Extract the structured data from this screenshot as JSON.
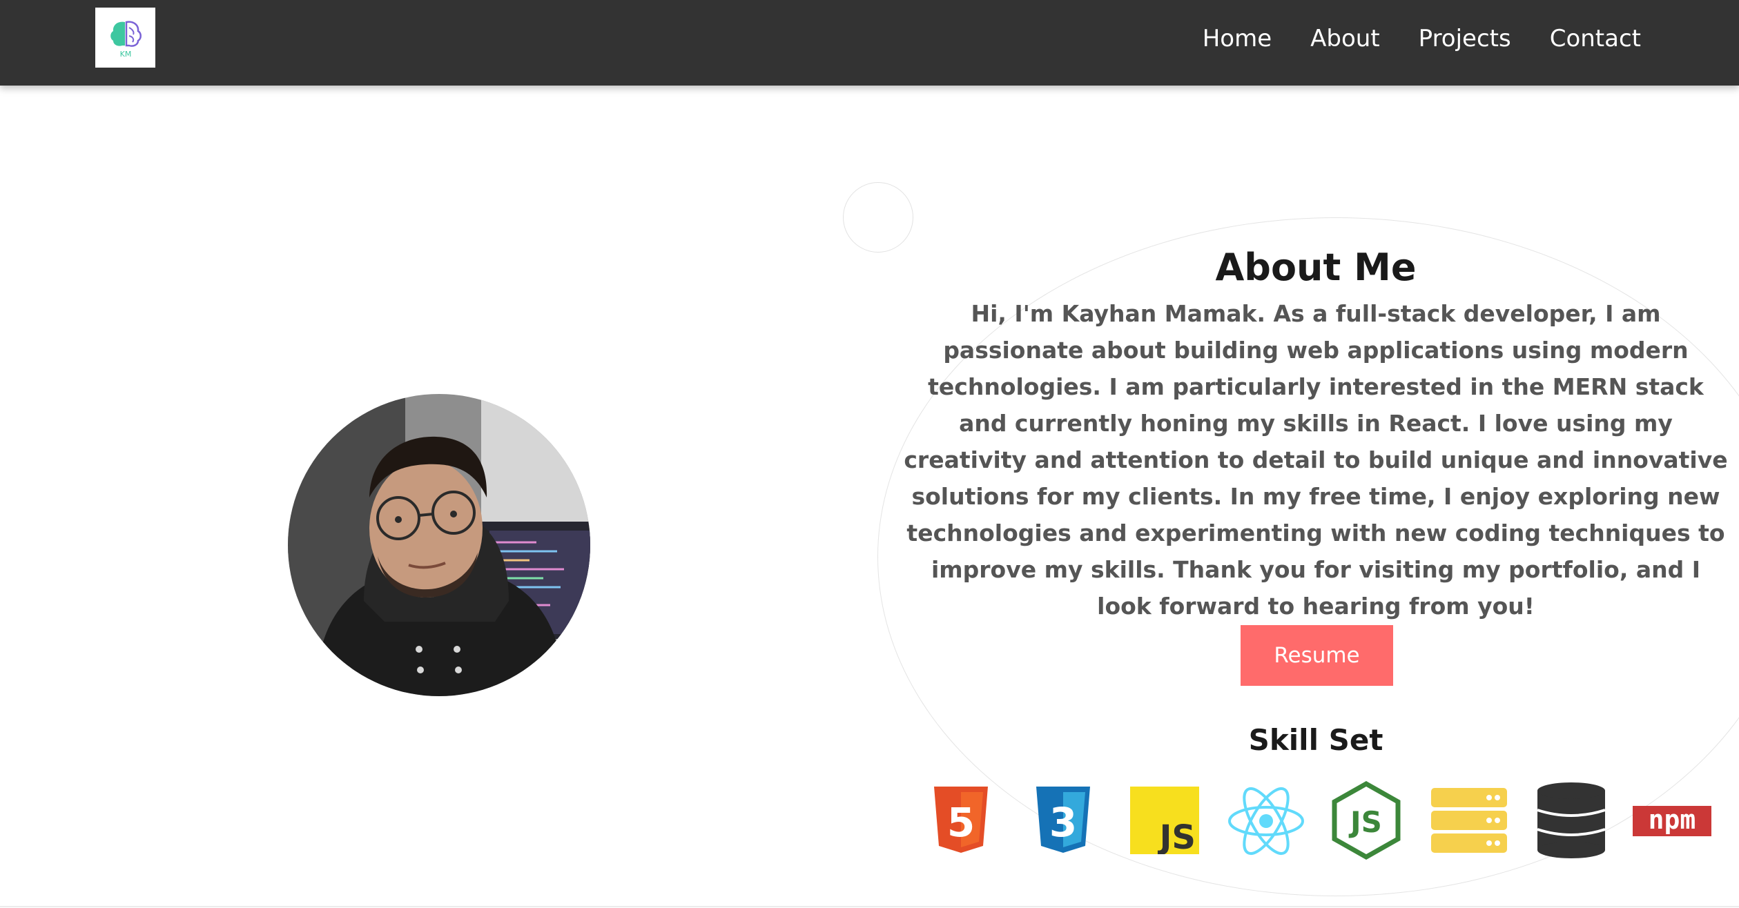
{
  "nav": {
    "logo_text": "KM",
    "links": [
      "Home",
      "About",
      "Projects",
      "Contact"
    ]
  },
  "about": {
    "title": "About Me",
    "paragraph": "Hi, I'm Kayhan Mamak. As a full-stack developer, I am passionate about building web applications using modern technologies. I am particularly interested in the MERN stack and currently honing my skills in React. I love using my creativity and attention to detail to build unique and innovative solutions for my clients. In my free time, I enjoy exploring new technologies and experimenting with new coding techniques to improve my skills. Thank you for visiting my portfolio, and I look forward to hearing from you!",
    "resume_label": "Resume"
  },
  "skills": {
    "title": "Skill Set",
    "html_text": "5",
    "css_text": "3",
    "js_text": "JS",
    "node_text": "JS",
    "npm_text": "npm",
    "icons": [
      "html5-icon",
      "css3-icon",
      "javascript-icon",
      "react-icon",
      "nodejs-icon",
      "server-icon",
      "database-icon",
      "npm-icon"
    ]
  },
  "colors": {
    "navbar": "#333333",
    "resume_button": "#ff6b6b",
    "html5": "#e44d26",
    "css3": "#1572b6",
    "javascript": "#f7df1e",
    "react": "#61dafb",
    "nodejs": "#3c873a",
    "server": "#f6d04d",
    "database": "#333333",
    "npm": "#cb3837"
  }
}
